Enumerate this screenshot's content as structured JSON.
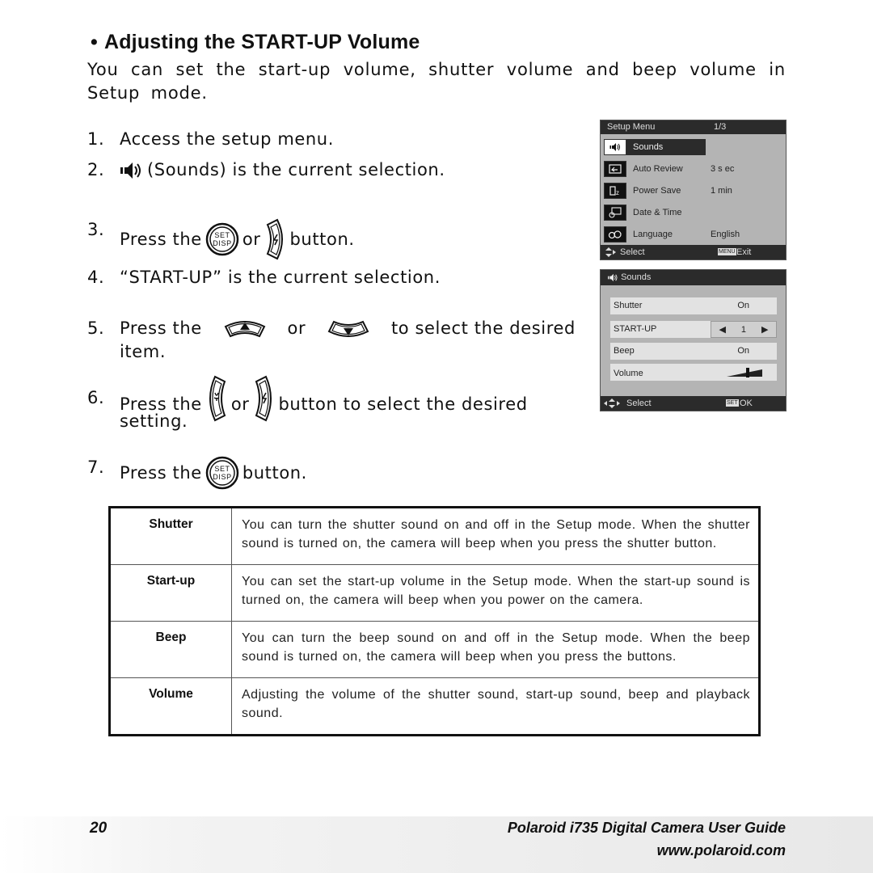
{
  "heading": {
    "bullet": "•",
    "title": "Adjusting the START-UP Volume"
  },
  "intro": "You can set the start-up volume, shutter volume and beep volume in Setup mode.",
  "steps": [
    {
      "num": "1.",
      "parts": [
        "Access the setup menu."
      ]
    },
    {
      "num": "2.",
      "parts": [
        "(Sounds) is the current selection."
      ]
    },
    {
      "num": "3.",
      "parts": [
        "Press the",
        "or",
        "button."
      ]
    },
    {
      "num": "4.",
      "parts": [
        "“START-UP” is the current selection."
      ]
    },
    {
      "num": "5.",
      "parts": [
        "Press the",
        "or",
        "to select the desired",
        "item."
      ]
    },
    {
      "num": "6.",
      "parts": [
        "Press the",
        "or",
        "button to select the desired",
        "setting."
      ]
    },
    {
      "num": "7.",
      "parts": [
        "Press the",
        "button."
      ]
    }
  ],
  "icons": {
    "set_disp": {
      "name": "set-disp-button",
      "line1": "SET",
      "line2": "DISP"
    },
    "flash_right": {
      "name": "flash-right-button"
    },
    "macro_left": {
      "name": "macro-left-button"
    },
    "up": {
      "name": "up-arrow-button"
    },
    "down": {
      "name": "down-arrow-button"
    },
    "sound": {
      "name": "sound-icon"
    }
  },
  "setup_menu": {
    "title": "Setup Menu",
    "page": "1/3",
    "items": [
      {
        "icon": "sound-icon",
        "label": "Sounds",
        "value": "",
        "selected": true
      },
      {
        "icon": "auto-review-icon",
        "label": "Auto Review",
        "value": "3 s ec",
        "selected": false
      },
      {
        "icon": "power-save-icon",
        "label": "Power Save",
        "value": "1 min",
        "selected": false
      },
      {
        "icon": "date-time-icon",
        "label": "Date & Time",
        "value": "",
        "selected": false
      },
      {
        "icon": "language-icon",
        "label": "Language",
        "value": "English",
        "selected": false
      }
    ],
    "footer_left": "Select",
    "footer_key": "MENU",
    "footer_right": "Exit"
  },
  "sounds_menu": {
    "title": "Sounds",
    "rows": [
      {
        "label": "Shutter",
        "value": "On"
      },
      {
        "label": "START-UP",
        "value": "1",
        "selected": true
      },
      {
        "label": "Beep",
        "value": "On"
      },
      {
        "label": "Volume",
        "value": "",
        "level": 0.6
      }
    ],
    "footer_left": "Select",
    "footer_key": "SET",
    "footer_right": "OK"
  },
  "table": [
    {
      "key": "Shutter",
      "desc": "You can turn the shutter sound on and off in the Setup mode. When the shutter sound is turned on, the camera will beep when you press the shutter button."
    },
    {
      "key": "Start-up",
      "desc": "You can set the start-up volume in the Setup mode. When the start-up sound is turned on, the camera will beep when you power on the camera."
    },
    {
      "key": "Beep",
      "desc": "You can turn the beep sound on and off in the Setup mode. When the beep sound is turned on, the camera will beep when you press the buttons."
    },
    {
      "key": "Volume",
      "desc": "Adjusting the volume of the shutter sound, start-up sound, beep and playback sound."
    }
  ],
  "footer": {
    "page_number": "20",
    "guide_title": "Polaroid i735 Digital Camera User Guide",
    "url": "www.polaroid.com"
  },
  "colors": {
    "screen_dark": "#2b2b2b",
    "screen_bg": "#b4b4b4",
    "row_bg": "#e2e2e2"
  }
}
